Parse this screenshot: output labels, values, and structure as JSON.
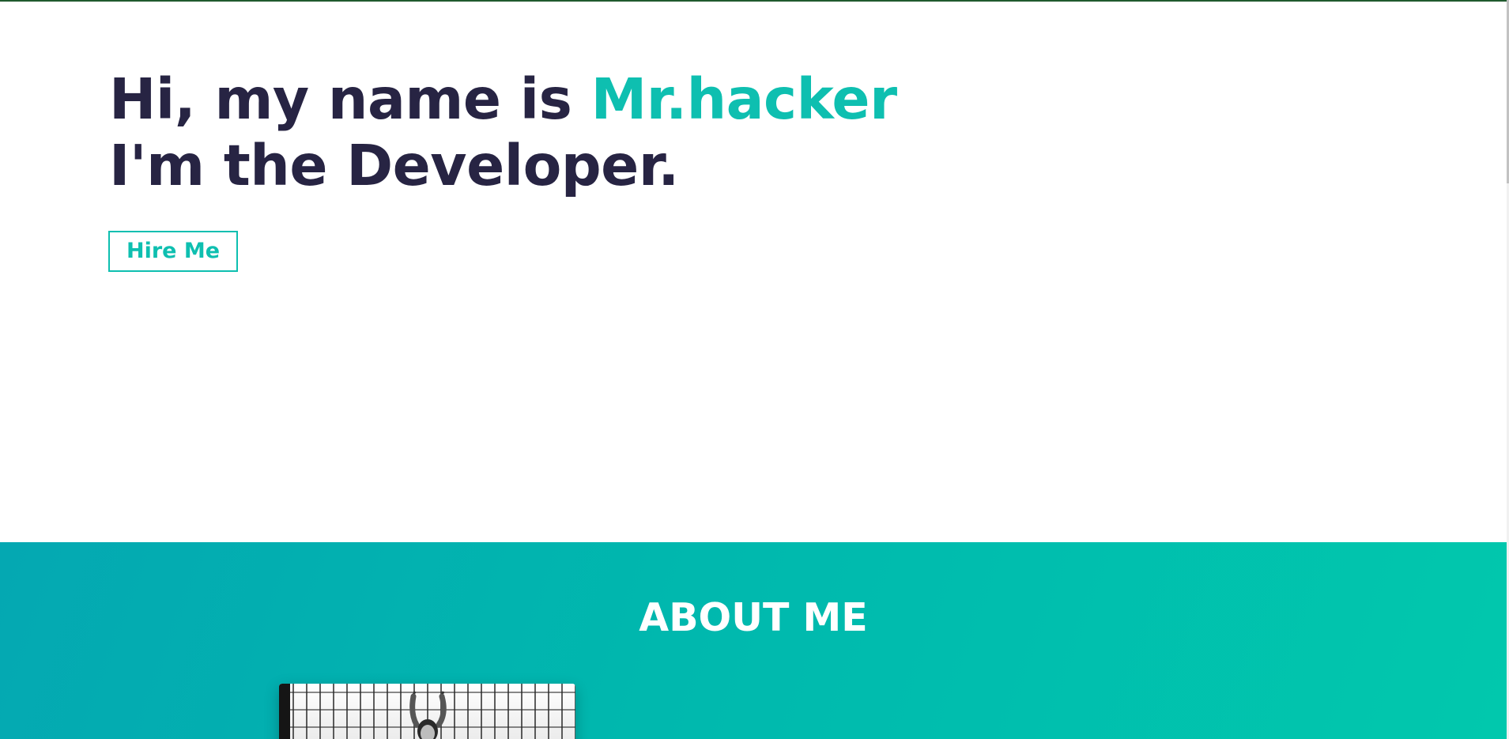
{
  "hero": {
    "intro_text": "Hi, my name is ",
    "name": "Mr.hacker",
    "role_line": "I'm the Developer.",
    "hire_button_label": "Hire Me"
  },
  "about": {
    "title": "ABOUT ME"
  },
  "colors": {
    "accent": "#0ebfb0",
    "heading": "#272443",
    "about_gradient_start": "#04a8b2",
    "about_gradient_end": "#01c8ad"
  },
  "icons": {
    "photo": "person-photo"
  }
}
